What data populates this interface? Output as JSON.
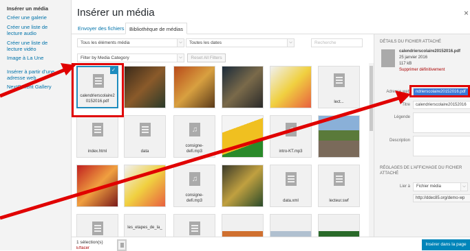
{
  "sidebar": {
    "items": [
      {
        "label": "Insérer un média",
        "active": true
      },
      {
        "label": "Créer une galerie",
        "active": false
      },
      {
        "label": "Créer une liste de lecture audio",
        "active": false
      },
      {
        "label": "Créer une liste de lecture vidéo",
        "active": false
      },
      {
        "label": "Image à La Une",
        "active": false
      },
      {
        "label": "Insérer à partir d’une adresse web",
        "active": false
      },
      {
        "label": "NextCellent Gallery",
        "active": false
      }
    ]
  },
  "header": {
    "title": "Insérer un média",
    "close": "×"
  },
  "tabs": {
    "upload": "Envoyer des fichiers",
    "library": "Bibliothèque de médias"
  },
  "filters": {
    "type": "Tous les éléments média",
    "dates": "Toutes les dates",
    "category": "Filter by Media Category",
    "reset": "Reset All Filters",
    "search_placeholder": "Recherche"
  },
  "grid": {
    "selected_file": "calendrierscolaire20152016.pdf",
    "row2": [
      "index.html",
      "data",
      "consigne-defi.mp3",
      "",
      "intro-KT.mp3",
      ""
    ],
    "row3": [
      "",
      "",
      "consigne-defi.mp3",
      "",
      "data.xml",
      "lecteur.swf"
    ],
    "row4": [
      "",
      "les_etapes_de_la_",
      "",
      "",
      "",
      ""
    ],
    "row1_last": "lect..."
  },
  "details": {
    "heading": "Détails du fichier attaché",
    "filename": "calendrierscolaire20152016.pdf",
    "date": "25 janvier 2016",
    "size": "117 kB",
    "delete": "Supprimer définitivement",
    "url_label": "Adresse web",
    "url_value": "ndrierscolaire20152016.pdf",
    "title_label": "Titre",
    "title_value": "calendrierscolaire20152016",
    "caption_label": "Légende",
    "description_label": "Description",
    "display_heading": "Réglages de l’affichage du fichier attaché",
    "link_label": "Lier à",
    "link_value": "Fichier média",
    "link_url": "http://ddec85.org/demo-wp"
  },
  "footer": {
    "selection": "1 sélection(s)",
    "clear": "Effacer",
    "insert": "Insérer dans la page"
  },
  "colors": {
    "accent": "#0073aa",
    "annotation": "#e00000",
    "primary_button": "#0085ba"
  }
}
